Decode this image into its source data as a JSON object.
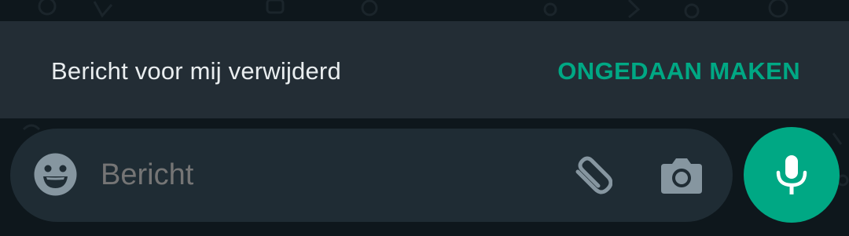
{
  "snackbar": {
    "message": "Bericht voor mij verwijderd",
    "action_label": "ONGEDAAN MAKEN"
  },
  "composer": {
    "placeholder": "Bericht",
    "emoji_icon": "emoji-icon",
    "attach_icon": "paperclip-icon",
    "camera_icon": "camera-icon",
    "mic_icon": "microphone-icon"
  },
  "colors": {
    "accent": "#00a884",
    "snackbar_bg": "#232d35",
    "composer_bg": "#1f2c34",
    "icon_gray": "#8696a0",
    "text_primary": "#e9edef"
  }
}
